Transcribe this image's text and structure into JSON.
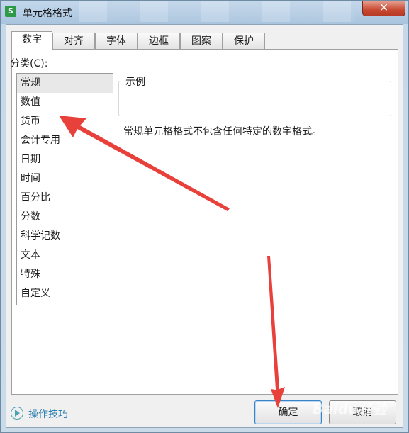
{
  "window": {
    "title": "单元格格式",
    "app_icon_letter": "S",
    "close_glyph": "✕"
  },
  "tabs": [
    {
      "label": "数字",
      "active": true
    },
    {
      "label": "对齐"
    },
    {
      "label": "字体"
    },
    {
      "label": "边框"
    },
    {
      "label": "图案"
    },
    {
      "label": "保护"
    }
  ],
  "category": {
    "label": "分类(C):",
    "items": [
      "常规",
      "数值",
      "货币",
      "会计专用",
      "日期",
      "时间",
      "百分比",
      "分数",
      "科学记数",
      "文本",
      "特殊",
      "自定义"
    ],
    "selected_index": 0
  },
  "sample": {
    "label": "示例",
    "value": ""
  },
  "description": "常规单元格格式不包含任何特定的数字格式。",
  "footer": {
    "tips_label": "操作技巧",
    "ok_label": "确定",
    "cancel_label": "取消"
  },
  "watermark": "Baidu经验",
  "colors": {
    "arrow": "#e8403a",
    "tips": "#2a7fb0",
    "close": "#c84a33"
  }
}
